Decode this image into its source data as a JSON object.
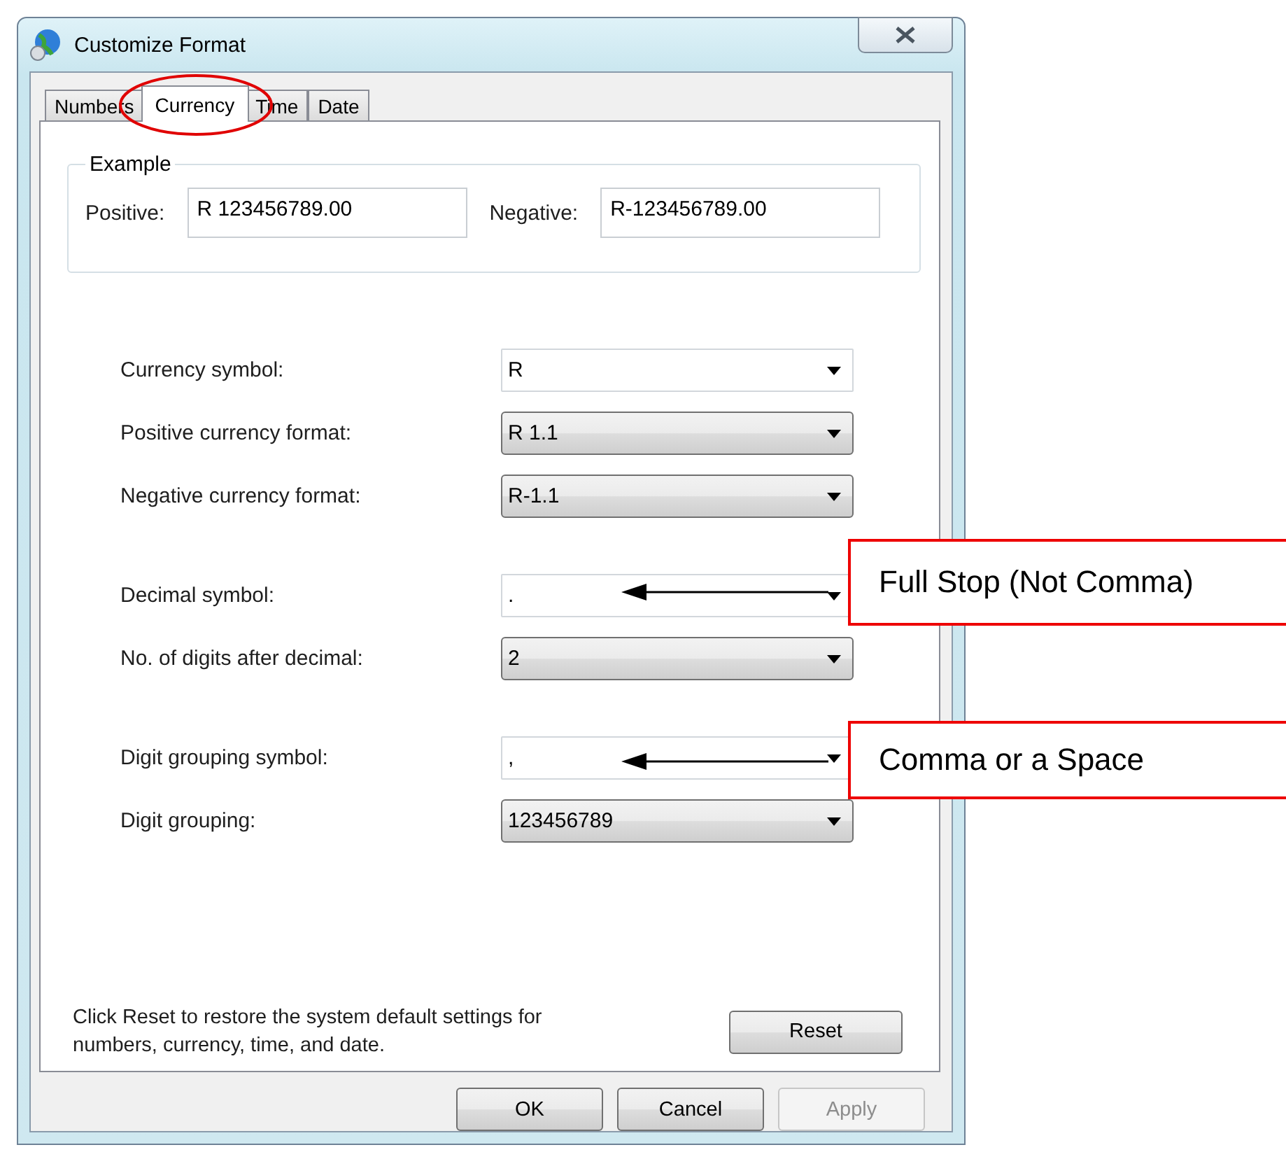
{
  "window": {
    "title": "Customize Format"
  },
  "tabs": [
    {
      "label": "Numbers",
      "selected": false
    },
    {
      "label": "Currency",
      "selected": true
    },
    {
      "label": "Time",
      "selected": false
    },
    {
      "label": "Date",
      "selected": false
    }
  ],
  "example": {
    "title": "Example",
    "positive_label": "Positive:",
    "positive_value": "R 123456789.00",
    "negative_label": "Negative:",
    "negative_value": "R-123456789.00"
  },
  "setting_groups": [
    [
      {
        "label": "Currency symbol:",
        "value": "R",
        "kind": "editable"
      },
      {
        "label": "Positive currency format:",
        "value": "R 1.1",
        "kind": "dropdown"
      },
      {
        "label": "Negative currency format:",
        "value": "R-1.1",
        "kind": "dropdown"
      }
    ],
    [
      {
        "label": "Decimal symbol:",
        "value": ".",
        "kind": "editable"
      },
      {
        "label": "No. of digits after decimal:",
        "value": "2",
        "kind": "dropdown"
      }
    ],
    [
      {
        "label": "Digit grouping symbol:",
        "value": ",",
        "kind": "editable"
      },
      {
        "label": "Digit grouping:",
        "value": "123456789",
        "kind": "dropdown"
      }
    ]
  ],
  "reset_note": "Click Reset to restore the system default settings for numbers, currency, time, and date.",
  "reset_button": "Reset",
  "buttons": [
    {
      "label": "OK",
      "disabled": false
    },
    {
      "label": "Cancel",
      "disabled": false
    },
    {
      "label": "Apply",
      "disabled": true
    }
  ],
  "annotations": [
    {
      "text": "Full Stop (Not Comma)"
    },
    {
      "text": "Comma or a Space"
    }
  ]
}
